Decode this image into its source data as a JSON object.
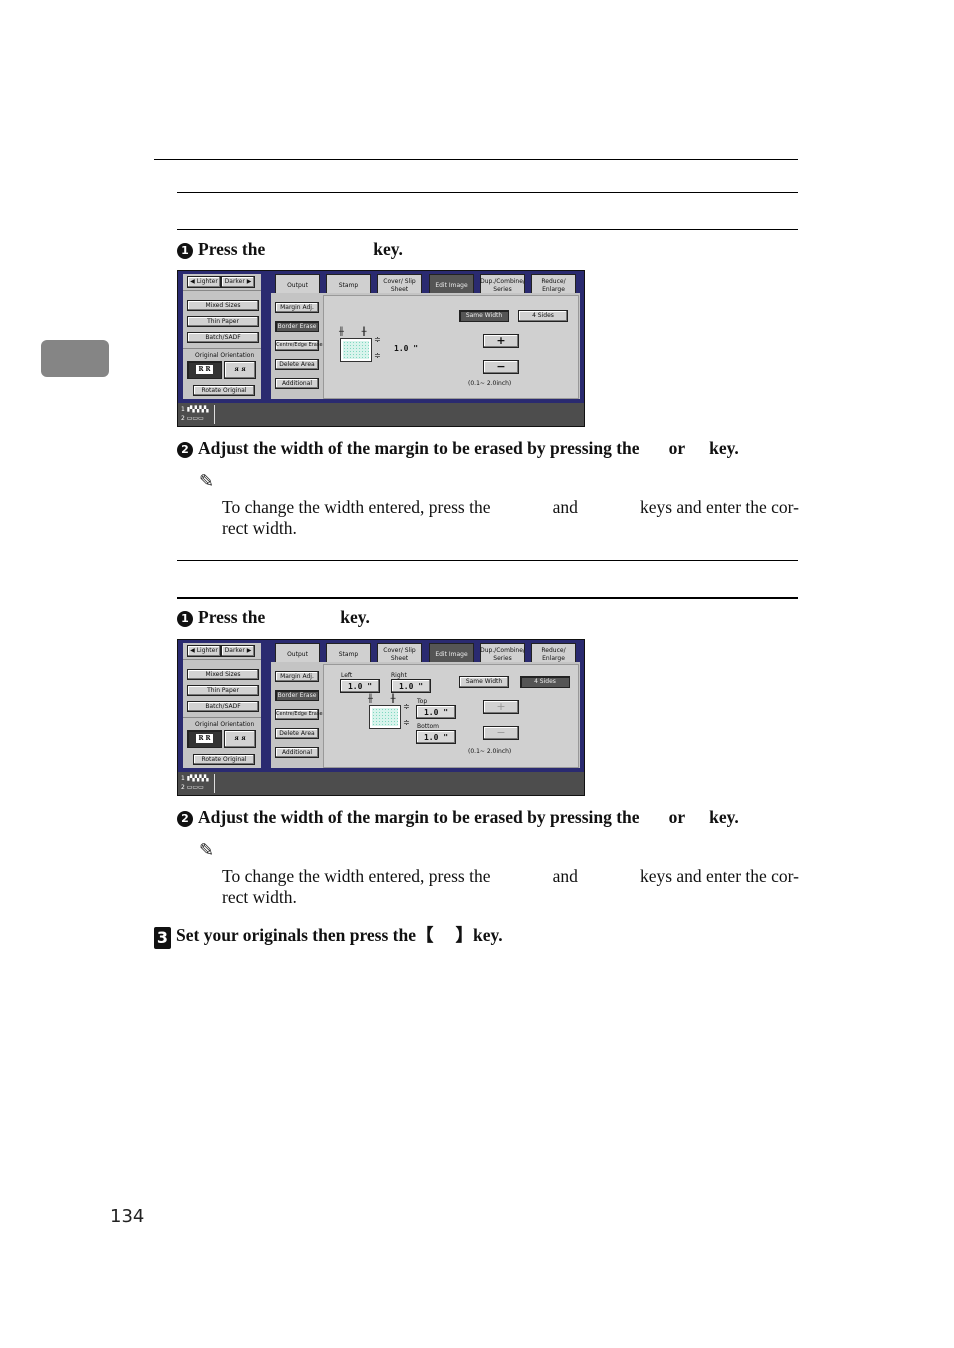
{
  "page": {
    "number": "134",
    "tab_marker_color": "#858585"
  },
  "section1": {
    "step1": {
      "num": "1",
      "text_before": "Press the",
      "text_after": "key."
    },
    "step2": {
      "num": "2",
      "text": "Adjust the width of the margin to be erased by pressing the",
      "or": "or",
      "key": "key."
    },
    "note": {
      "icon": "pencil-note-icon",
      "line1_a": "To change the width entered, press the",
      "line1_b": "and",
      "line1_c": "keys and enter the cor-",
      "line2": "rect width."
    },
    "panel": {
      "lighter": "Lighter",
      "darker": "Darker",
      "left_buttons": [
        "Mixed Sizes",
        "Thin Paper",
        "Batch/SADF"
      ],
      "orientation_label": "Original Orientation",
      "rotate": "Rotate Original",
      "tabs": [
        "Output",
        "Stamp",
        "Cover/ Slip Sheet",
        "Edit Image",
        "Dup./Combine/ Series",
        "Reduce/ Enlarge"
      ],
      "selected_tab": "Edit Image",
      "submenu": [
        "Margin Adj.",
        "Border Erase",
        "Centre/Edge Erase",
        "Delete Area",
        "Additional"
      ],
      "selected_submenu": "Border Erase",
      "same_width": "Same Width",
      "four_sides": "4 Sides",
      "mode_selected": "Same Width",
      "value": "1.0 \"",
      "plus": "+",
      "minus": "−",
      "range": "(0.1~ 2.0inch)",
      "status_lines": [
        "1",
        "2"
      ]
    }
  },
  "section2": {
    "step1": {
      "num": "1",
      "text_before": "Press the",
      "text_after": "key."
    },
    "step2": {
      "num": "2",
      "text": "Adjust the width of the margin to be erased by pressing the",
      "or": "or",
      "key": "key."
    },
    "note": {
      "icon": "pencil-note-icon",
      "line1_a": "To change the width entered, press the",
      "line1_b": "and",
      "line1_c": "keys and enter the cor-",
      "line2": "rect width."
    },
    "panel": {
      "lighter": "Lighter",
      "darker": "Darker",
      "left_buttons": [
        "Mixed Sizes",
        "Thin Paper",
        "Batch/SADF"
      ],
      "orientation_label": "Original Orientation",
      "rotate": "Rotate Original",
      "tabs": [
        "Output",
        "Stamp",
        "Cover/ Slip Sheet",
        "Edit Image",
        "Dup./Combine/ Series",
        "Reduce/ Enlarge"
      ],
      "selected_tab": "Edit Image",
      "submenu": [
        "Margin Adj.",
        "Border Erase",
        "Centre/Edge Erase",
        "Delete Area",
        "Additional"
      ],
      "selected_submenu": "Border Erase",
      "same_width": "Same Width",
      "four_sides": "4 Sides",
      "mode_selected": "4 Sides",
      "left_label": "Left",
      "left_value": "1.0 \"",
      "right_label": "Right",
      "right_value": "1.0 \"",
      "top_label": "Top",
      "top_value": "1.0 \"",
      "bottom_label": "Bottom",
      "bottom_value": "1.0 \"",
      "plus": "+",
      "minus": "−",
      "range": "(0.1~ 2.0inch)",
      "status_lines": [
        "1",
        "2"
      ]
    }
  },
  "step3": {
    "num": "3",
    "text_before": "Set your originals then press the",
    "bracket_open": "【",
    "bracket_close": "】",
    "text_after": "key."
  }
}
